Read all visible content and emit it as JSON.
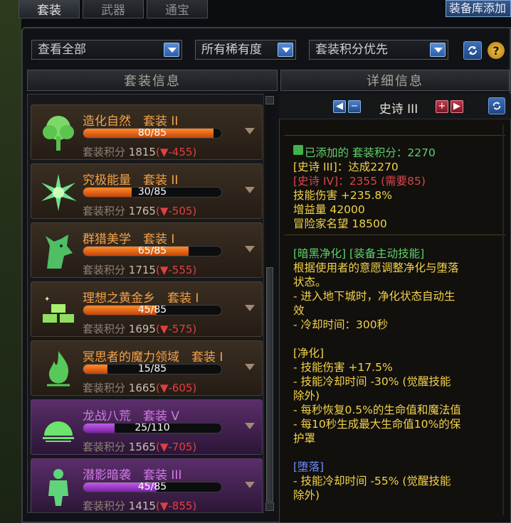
{
  "top_tabs": [
    "套装",
    "武器",
    "通宝"
  ],
  "top_right_button": "装备库添加",
  "filters": {
    "view": "查看全部",
    "rarity": "所有稀有度",
    "sort": "套装积分优先"
  },
  "icons": {
    "refresh": "refresh-icon",
    "help": "?"
  },
  "headers": {
    "left": "套装信息",
    "right": "详细信息"
  },
  "level_nav": {
    "label": "史诗 III",
    "prev": "◀",
    "minus": "−",
    "plus": "+",
    "next": "▶"
  },
  "colors": {
    "orange_bar": "#ff8c2a",
    "purple_bar": "#b04fe0",
    "negative": "#e04040",
    "gold_text": "#f2d24a"
  },
  "sets": [
    {
      "name": "造化自然",
      "type": "套装 II",
      "current": 80,
      "max": 85,
      "progress_text": "80/85",
      "score_label": "套装积分",
      "score": "1815",
      "diff": "(▼-455)",
      "rarity": "epic",
      "icon": "tree-icon"
    },
    {
      "name": "究极能量",
      "type": "套装 II",
      "current": 30,
      "max": 85,
      "progress_text": "30/85",
      "score_label": "套装积分",
      "score": "1765",
      "diff": "(▼-505)",
      "rarity": "epic",
      "icon": "energy-burst-icon"
    },
    {
      "name": "群猎美学",
      "type": "套装 I",
      "current": 65,
      "max": 85,
      "progress_text": "65/85",
      "score_label": "套装积分",
      "score": "1715",
      "diff": "(▼-555)",
      "rarity": "epic",
      "icon": "wolf-icon"
    },
    {
      "name": "理想之黄金乡",
      "type": "套装 I",
      "current": 45,
      "max": 85,
      "progress_text": "45/85",
      "score_label": "套装积分",
      "score": "1695",
      "diff": "(▼-575)",
      "rarity": "epic",
      "icon": "gold-bars-icon"
    },
    {
      "name": "冥思者的魔力领域",
      "type": "套装 I",
      "current": 15,
      "max": 85,
      "progress_text": "15/85",
      "score_label": "套装积分",
      "score": "1665",
      "diff": "(▼-605)",
      "rarity": "epic",
      "icon": "flame-icon"
    },
    {
      "name": "龙战八荒",
      "type": "套装 V",
      "current": 25,
      "max": 110,
      "progress_text": "25/110",
      "score_label": "套装积分",
      "score": "1565",
      "diff": "(▼-705)",
      "rarity": "legend",
      "icon": "sunrise-icon"
    },
    {
      "name": "潜影暗袭",
      "type": "套装 III",
      "current": 45,
      "max": 85,
      "progress_text": "45/85",
      "score_label": "套装积分",
      "score": "1415",
      "diff": "(▼-855)",
      "rarity": "legend",
      "icon": "figure-icon"
    }
  ],
  "detail": {
    "added_label": "已添加的 套装积分：2270",
    "achieved": "[史诗 III]：达成2270",
    "next_tier": "[史诗 IV]：2355 (需要85)",
    "skill_damage": "技能伤害 +235.8%",
    "gain": "增益量 42000",
    "fame": "冒险家名望 18500",
    "skill_title": "[暗黑净化] [装备主动技能]",
    "skill_desc_1": "根据使用者的意愿调整净化与堕落",
    "skill_desc_2": "状态。",
    "skill_desc_3": "- 进入地下城时，净化状态自动生",
    "skill_desc_4": "效",
    "skill_desc_5": "- 冷却时间：300秒",
    "purify_title": "[净化]",
    "purify_1": "- 技能伤害 +17.5%",
    "purify_2": "- 技能冷却时间 -30% (觉醒技能",
    "purify_3": "除外)",
    "purify_4": "- 每秒恢复0.5%的生命值和魔法值",
    "purify_5": "- 每10秒生成最大生命值10%的保",
    "purify_6": "护罩",
    "corrupt_title": "[堕落]",
    "corrupt_1": "- 技能冷却时间 -55% (觉醒技能",
    "corrupt_2": "除外)"
  }
}
